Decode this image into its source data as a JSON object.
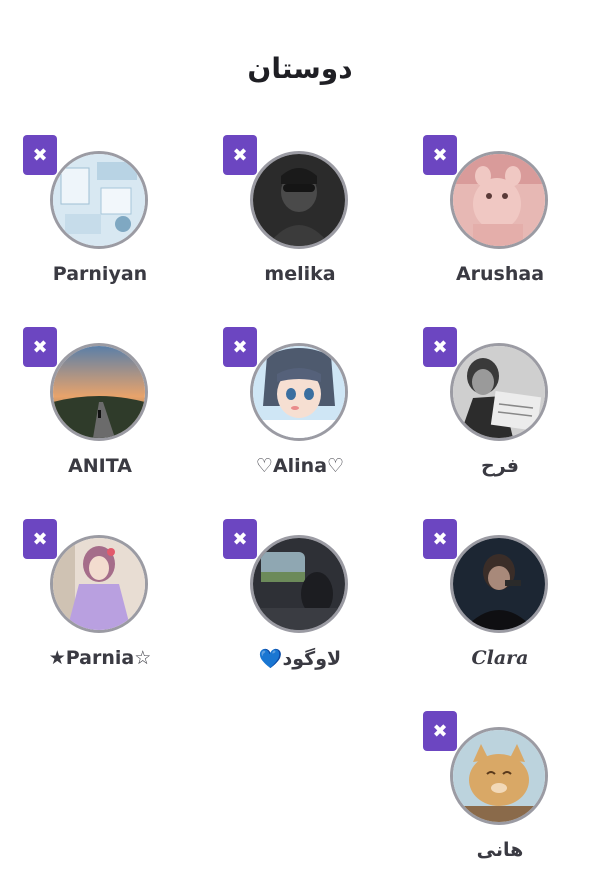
{
  "page": {
    "title": "دوستان"
  },
  "icons": {
    "remove": "close-icon",
    "remove_glyph": "✖"
  },
  "colors": {
    "remove_button": "#6c46c1",
    "avatar_border": "#9b9ba3"
  },
  "friends": [
    {
      "name": "Arushaa"
    },
    {
      "name": "melika"
    },
    {
      "name": "Parniyan"
    },
    {
      "name": "فرح"
    },
    {
      "name": "♡Alina♡"
    },
    {
      "name": "ANITA"
    },
    {
      "name": "Clara"
    },
    {
      "name": "لاوگود💙"
    },
    {
      "name": "★Parnia☆"
    },
    {
      "name": "هانی"
    }
  ]
}
